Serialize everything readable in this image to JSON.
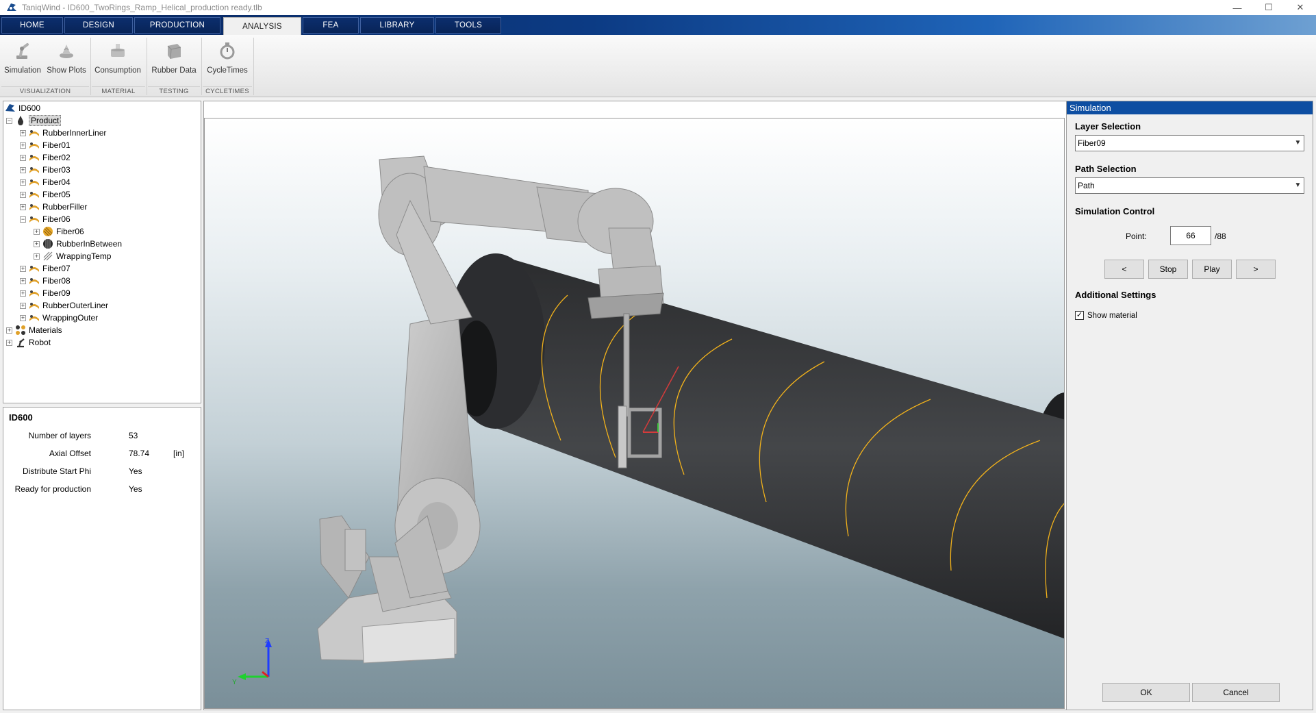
{
  "window": {
    "title": "TaniqWind - ID600_TwoRings_Ramp_Helical_production ready.tlb",
    "minimize": "—",
    "maximize": "☐",
    "close": "✕"
  },
  "tabs": [
    "HOME",
    "DESIGN",
    "PRODUCTION",
    "ANALYSIS",
    "FEA",
    "LIBRARY",
    "TOOLS"
  ],
  "active_tab": "ANALYSIS",
  "ribbon": {
    "buttons": [
      "Simulation",
      "Show Plots",
      "Consumption",
      "Rubber Data",
      "CycleTimes"
    ],
    "groups": [
      "VISUALIZATION",
      "MATERIAL",
      "TESTING",
      "CYCLETIMES"
    ]
  },
  "tree": {
    "root": "ID600",
    "items": [
      {
        "label": "Product"
      },
      {
        "label": "RubberInnerLiner"
      },
      {
        "label": "Fiber01"
      },
      {
        "label": "Fiber02"
      },
      {
        "label": "Fiber03"
      },
      {
        "label": "Fiber04"
      },
      {
        "label": "Fiber05"
      },
      {
        "label": "RubberFiller"
      },
      {
        "label": "Fiber06"
      },
      {
        "label": "Fiber06"
      },
      {
        "label": "RubberInBetween"
      },
      {
        "label": "WrappingTemp"
      },
      {
        "label": "Fiber07"
      },
      {
        "label": "Fiber08"
      },
      {
        "label": "Fiber09"
      },
      {
        "label": "RubberOuterLiner"
      },
      {
        "label": "WrappingOuter"
      },
      {
        "label": "Materials"
      },
      {
        "label": "Robot"
      }
    ],
    "expander_plus": "+",
    "expander_minus": "−"
  },
  "properties": {
    "title": "ID600",
    "rows": [
      {
        "key": "Number of layers",
        "value": "53",
        "unit": ""
      },
      {
        "key": "Axial Offset",
        "value": "78.74",
        "unit": "[in]"
      },
      {
        "key": "Distribute Start Phi",
        "value": "Yes",
        "unit": ""
      },
      {
        "key": "Ready for production",
        "value": "Yes",
        "unit": ""
      }
    ]
  },
  "viewport": {
    "axis_z": "Z",
    "axis_y": "Y"
  },
  "simulation": {
    "header": "Simulation",
    "layer_selection_title": "Layer Selection",
    "layer_value": "Fiber09",
    "path_selection_title": "Path Selection",
    "path_value": "Path",
    "control_title": "Simulation Control",
    "point_label": "Point:",
    "point_value": "66",
    "point_total": "/88",
    "prev_label": "<",
    "stop_label": "Stop",
    "play_label": "Play",
    "next_label": ">",
    "additional_title": "Additional Settings",
    "show_material_label": "Show material",
    "show_material_checked": true,
    "check_mark": "✓",
    "ok_label": "OK",
    "cancel_label": "Cancel",
    "dropdown_arrow": "▼"
  },
  "colors": {
    "tab_bar": "#0c3b84",
    "panel_header": "#0d4ea2",
    "fiber_line": "#f2b21b",
    "mandrel": "#3b3d40",
    "robot": "#b4b4b4"
  }
}
